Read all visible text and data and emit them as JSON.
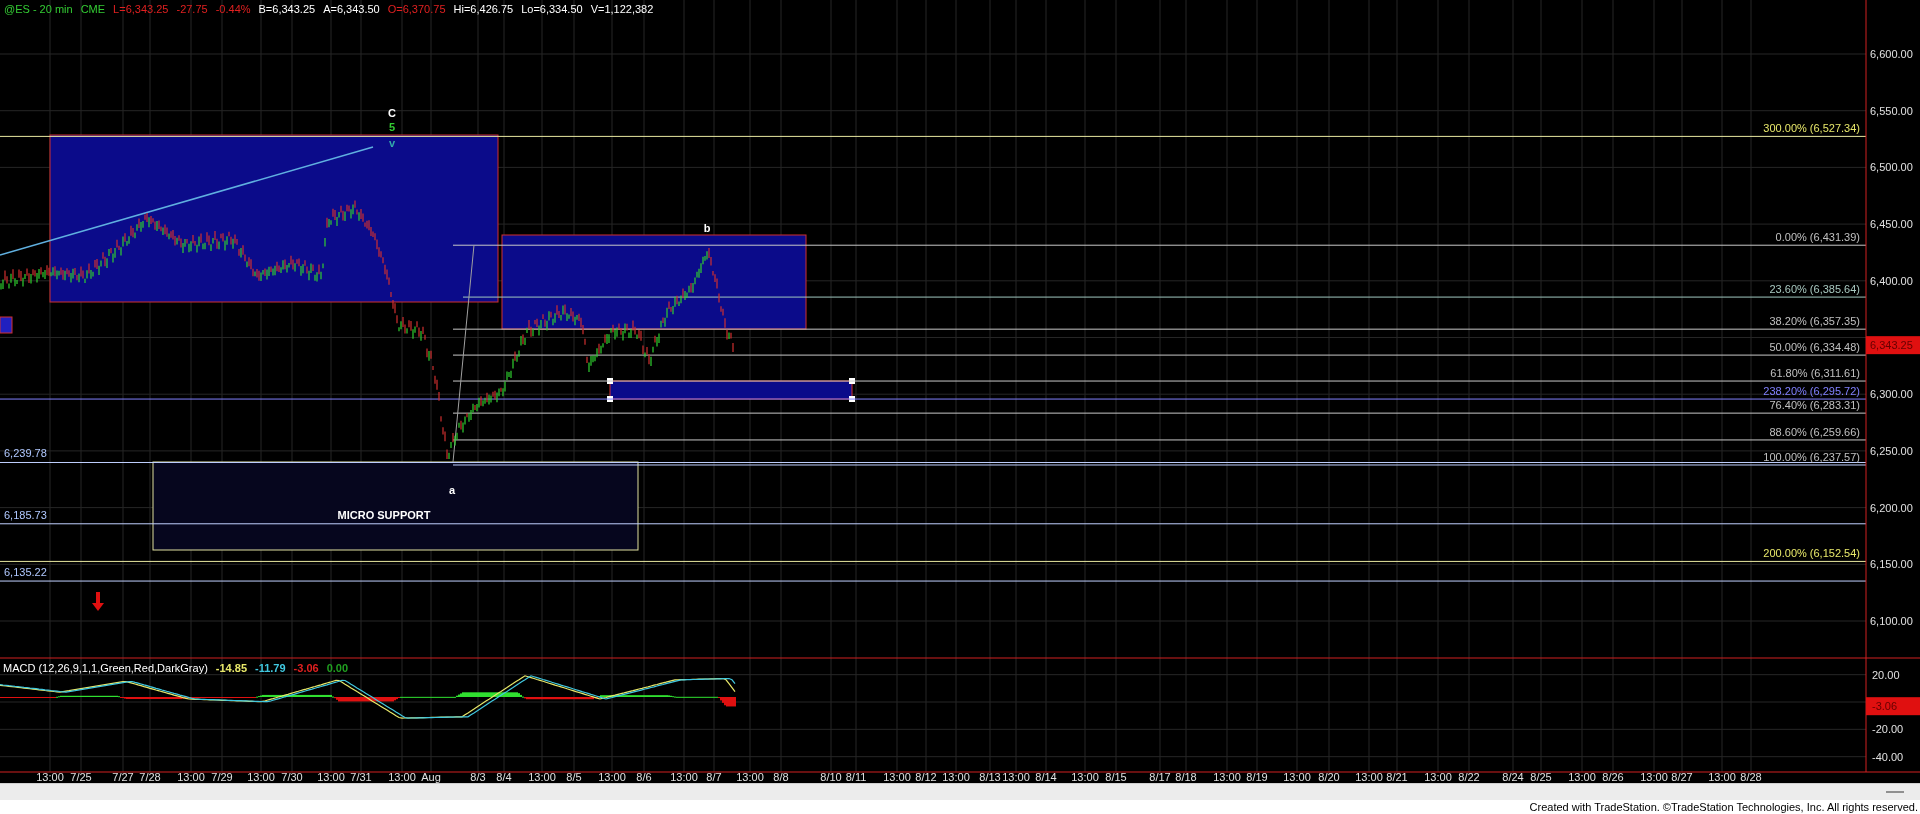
{
  "chart": {
    "header": [
      {
        "text": "@ES - 20 min",
        "color": "#33cc33"
      },
      {
        "text": "CME",
        "color": "#33cc33"
      },
      {
        "text": "L=6,343.25",
        "color": "#e02020"
      },
      {
        "text": "-27.75",
        "color": "#e02020"
      },
      {
        "text": "-0.44%",
        "color": "#e02020"
      },
      {
        "text": "B=6,343.25",
        "color": "#ffffff"
      },
      {
        "text": "A=6,343.50",
        "color": "#ffffff"
      },
      {
        "text": "O=6,370.75",
        "color": "#e02020"
      },
      {
        "text": "Hi=6,426.75",
        "color": "#ffffff"
      },
      {
        "text": "Lo=6,334.50",
        "color": "#ffffff"
      },
      {
        "text": "V=1,122,382",
        "color": "#ffffff"
      }
    ],
    "wave_labels": [
      {
        "text": "C",
        "color": "#ffffff"
      },
      {
        "text": "5",
        "color": "#33cc33"
      },
      {
        "text": "v",
        "color": "#33aaaa"
      },
      {
        "text": "b",
        "color": "#ffffff"
      },
      {
        "text": "a",
        "color": "#ffffff"
      }
    ],
    "fib_levels": [
      {
        "label": "300.00% (6,527.34)",
        "color": "#e8e86a"
      },
      {
        "label": "0.00% (6,431.39)",
        "color": "#c0c0c0"
      },
      {
        "label": "23.60% (6,385.64)",
        "color": "#a8c8c0"
      },
      {
        "label": "38.20% (6,357.35)",
        "color": "#c0c0c0"
      },
      {
        "label": "50.00% (6,334.48)",
        "color": "#c0c0c0"
      },
      {
        "label": "61.80% (6,311.61)",
        "color": "#c0c0c0"
      },
      {
        "label": "238.20% (6,295.72)",
        "color": "#8080ff"
      },
      {
        "label": "76.40% (6,283.31)",
        "color": "#c0c0c0"
      },
      {
        "label": "88.60% (6,259.66)",
        "color": "#c0c0c0"
      },
      {
        "label": "100.00% (6,237.57)",
        "color": "#c0c0c0"
      },
      {
        "label": "200.00% (6,152.54)",
        "color": "#e8e86a"
      }
    ],
    "price_marks": [
      "6,239.78",
      "6,185.73",
      "6,135.22"
    ],
    "zone_label": "MICRO SUPPORT",
    "price_axis": [
      "6,600.00",
      "6,550.00",
      "6,500.00",
      "6,450.00",
      "6,400.00",
      "6,300.00",
      "6,250.00",
      "6,200.00",
      "6,150.00",
      "6,100.00"
    ],
    "last_price": "6,343.25",
    "macd": {
      "title": "MACD (12,26,9,1,1,Green,Red,DarkGray)",
      "values": [
        {
          "text": "-14.85",
          "color": "#e8e86a"
        },
        {
          "text": "-11.79",
          "color": "#40c8e0"
        },
        {
          "text": "-3.06",
          "color": "#e02020"
        },
        {
          "text": "0.00",
          "color": "#20a020"
        }
      ],
      "axis": [
        "20.00",
        "-20.00",
        "-40.00"
      ],
      "last": "-3.06"
    },
    "time_axis": [
      "13:00",
      "7/25",
      "7/27",
      "7/28",
      "13:00",
      "7/29",
      "13:00",
      "7/30",
      "13:00",
      "7/31",
      "13:00",
      "Aug",
      "8/3",
      "8/4",
      "13:00",
      "8/5",
      "13:00",
      "8/6",
      "13:00",
      "8/7",
      "13:00",
      "8/8",
      "8/10",
      "8/11",
      "13:00",
      "8/12",
      "13:00",
      "8/13",
      "13:00",
      "8/14",
      "13:00",
      "8/15",
      "8/17",
      "8/18",
      "13:00",
      "8/19",
      "13:00",
      "8/20",
      "13:00",
      "8/21",
      "13:00",
      "8/22",
      "8/24",
      "8/25",
      "13:00",
      "8/26",
      "13:00",
      "8/27",
      "13:00",
      "8/28"
    ]
  },
  "footer": "Created with TradeStation. ©TradeStation Technologies, Inc. All rights reserved."
}
